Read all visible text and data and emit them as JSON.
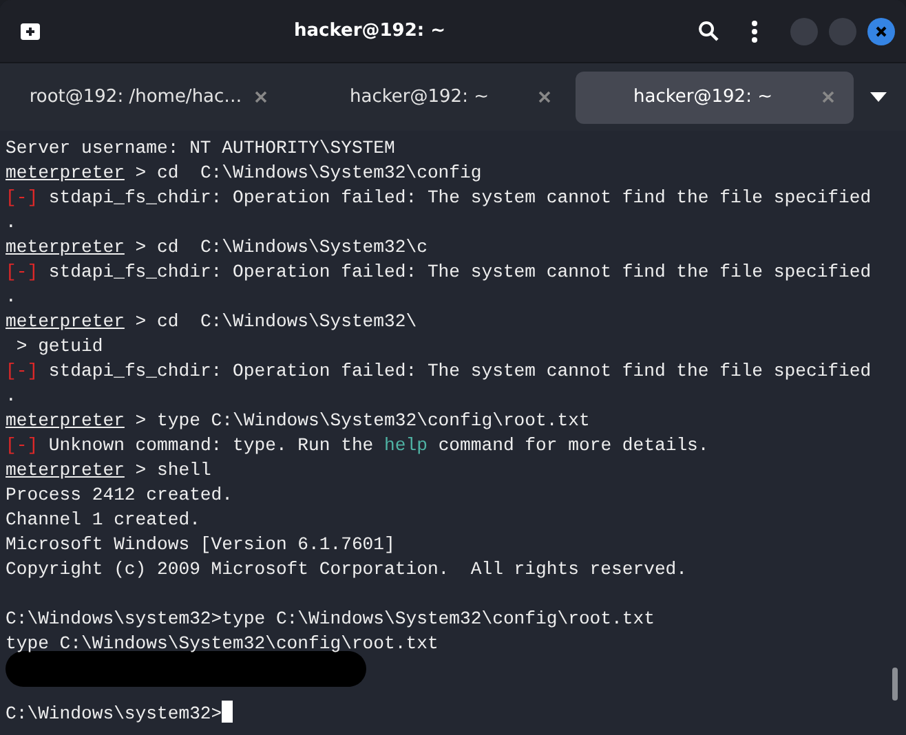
{
  "window": {
    "title": "hacker@192: ~"
  },
  "tabs": [
    {
      "label": "root@192: /home/hac…",
      "selected": false
    },
    {
      "label": "hacker@192: ~",
      "selected": false
    },
    {
      "label": "hacker@192: ~",
      "selected": true
    }
  ],
  "terminal": {
    "lines": [
      {
        "kind": "text",
        "segments": [
          {
            "kind": "plain",
            "text": "Server username: NT AUTHORITY\\SYSTEM"
          }
        ]
      },
      {
        "kind": "text",
        "segments": [
          {
            "kind": "prompt",
            "text": "meterpreter"
          },
          {
            "kind": "plain",
            "text": " > cd  C:\\Windows\\System32\\config"
          }
        ]
      },
      {
        "kind": "text",
        "segments": [
          {
            "kind": "error",
            "text": "[-]"
          },
          {
            "kind": "plain",
            "text": " stdapi_fs_chdir: Operation failed: The system cannot find the file specified"
          }
        ]
      },
      {
        "kind": "text",
        "segments": [
          {
            "kind": "plain",
            "text": "."
          }
        ]
      },
      {
        "kind": "text",
        "segments": [
          {
            "kind": "prompt",
            "text": "meterpreter"
          },
          {
            "kind": "plain",
            "text": " > cd  C:\\Windows\\System32\\c"
          }
        ]
      },
      {
        "kind": "text",
        "segments": [
          {
            "kind": "error",
            "text": "[-]"
          },
          {
            "kind": "plain",
            "text": " stdapi_fs_chdir: Operation failed: The system cannot find the file specified"
          }
        ]
      },
      {
        "kind": "text",
        "segments": [
          {
            "kind": "plain",
            "text": "."
          }
        ]
      },
      {
        "kind": "text",
        "segments": [
          {
            "kind": "prompt",
            "text": "meterpreter"
          },
          {
            "kind": "plain",
            "text": " > cd  C:\\Windows\\System32\\"
          }
        ]
      },
      {
        "kind": "text",
        "segments": [
          {
            "kind": "plain",
            "text": " > getuid"
          }
        ]
      },
      {
        "kind": "text",
        "segments": [
          {
            "kind": "error",
            "text": "[-]"
          },
          {
            "kind": "plain",
            "text": " stdapi_fs_chdir: Operation failed: The system cannot find the file specified"
          }
        ]
      },
      {
        "kind": "text",
        "segments": [
          {
            "kind": "plain",
            "text": "."
          }
        ]
      },
      {
        "kind": "text",
        "segments": [
          {
            "kind": "prompt",
            "text": "meterpreter"
          },
          {
            "kind": "plain",
            "text": " > type C:\\Windows\\System32\\config\\root.txt"
          }
        ]
      },
      {
        "kind": "text",
        "segments": [
          {
            "kind": "error",
            "text": "[-]"
          },
          {
            "kind": "plain",
            "text": " Unknown command: type. Run the "
          },
          {
            "kind": "link",
            "text": "help"
          },
          {
            "kind": "plain",
            "text": " command for more details."
          }
        ]
      },
      {
        "kind": "text",
        "segments": [
          {
            "kind": "prompt",
            "text": "meterpreter"
          },
          {
            "kind": "plain",
            "text": " > shell"
          }
        ]
      },
      {
        "kind": "text",
        "segments": [
          {
            "kind": "plain",
            "text": "Process 2412 created."
          }
        ]
      },
      {
        "kind": "text",
        "segments": [
          {
            "kind": "plain",
            "text": "Channel 1 created."
          }
        ]
      },
      {
        "kind": "text",
        "segments": [
          {
            "kind": "plain",
            "text": "Microsoft Windows [Version 6.1.7601]"
          }
        ]
      },
      {
        "kind": "text",
        "segments": [
          {
            "kind": "plain",
            "text": "Copyright (c) 2009 Microsoft Corporation.  All rights reserved."
          }
        ]
      },
      {
        "kind": "blank"
      },
      {
        "kind": "text",
        "segments": [
          {
            "kind": "plain",
            "text": "C:\\Windows\\system32>type C:\\Windows\\System32\\config\\root.txt"
          }
        ]
      },
      {
        "kind": "text",
        "segments": [
          {
            "kind": "plain",
            "text": "type C:\\Windows\\System32\\config\\root.txt"
          }
        ]
      },
      {
        "kind": "redacted"
      },
      {
        "kind": "blank"
      },
      {
        "kind": "input",
        "segments": [
          {
            "kind": "plain",
            "text": "C:\\Windows\\system32>"
          }
        ]
      }
    ]
  }
}
